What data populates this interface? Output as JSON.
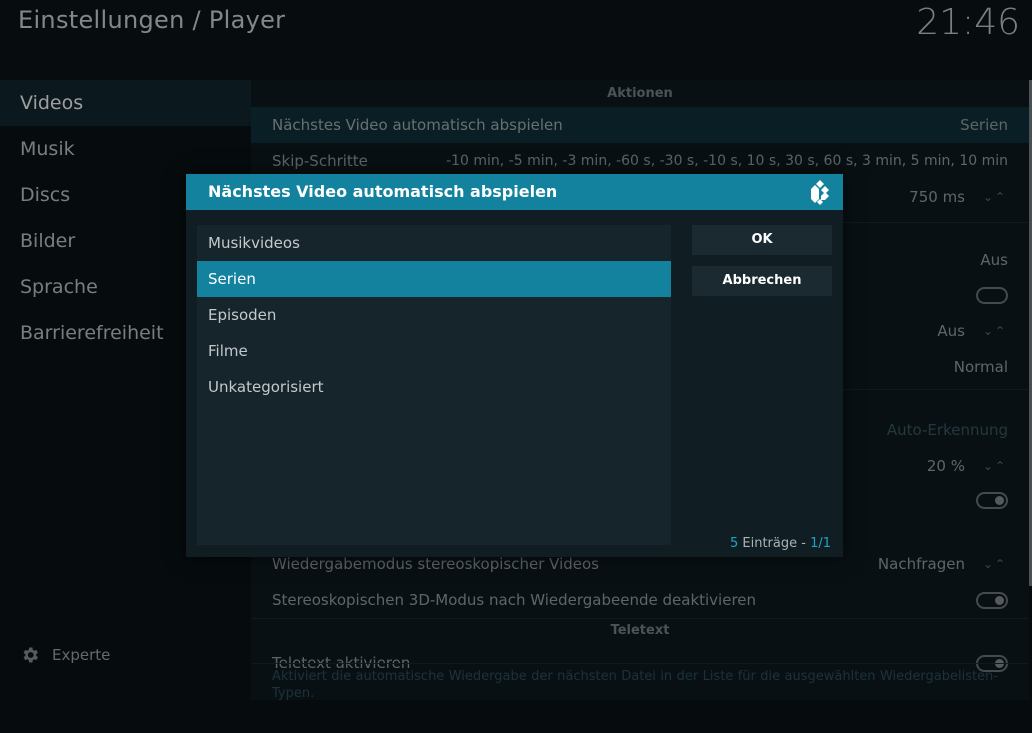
{
  "header": {
    "title": "Einstellungen / Player",
    "clock": "21:46"
  },
  "sidebar": {
    "items": [
      {
        "label": "Videos",
        "active": true
      },
      {
        "label": "Musik"
      },
      {
        "label": "Discs"
      },
      {
        "label": "Bilder"
      },
      {
        "label": "Sprache"
      },
      {
        "label": "Barrierefreiheit"
      }
    ],
    "expert_label": "Experte",
    "expert_icon": "gear-icon"
  },
  "settings": {
    "section_actions": "Aktionen",
    "rows": [
      {
        "label": "Nächstes Video automatisch abspielen",
        "value": "Serien"
      },
      {
        "label": "Skip-Schritte",
        "value": "-10 min, -5 min, -3 min, -60 s, -30 s, -10 s, 10 s, 30 s, 60 s, 3 min, 5 min, 10 min"
      },
      {
        "value": "750 ms"
      },
      {
        "value": "Aus"
      },
      {
        "value": "Aus"
      },
      {
        "value": "Normal"
      },
      {
        "value": "Auto-Erkennung"
      },
      {
        "value": "20 %"
      },
      {
        "label": "Wiedergabemodus stereoskopischer Videos",
        "value": "Nachfragen"
      },
      {
        "label": "Stereoskopischen 3D-Modus nach Wiedergabeende deaktivieren"
      },
      {
        "label": "Teletext aktivieren"
      }
    ],
    "section_teletext": "Teletext",
    "help_text": "Aktiviert die automatische Wiedergabe der nächsten Datei in der Liste für die ausgewählten Wiedergabelisten-Typen."
  },
  "dialog": {
    "title": "Nächstes Video automatisch abspielen",
    "logo_icon": "kodi-logo-icon",
    "options": [
      "Musikvideos",
      "Serien",
      "Episoden",
      "Filme",
      "Unkategorisiert"
    ],
    "selected_index": 1,
    "ok_label": "OK",
    "cancel_label": "Abbrechen",
    "count_num": "5",
    "count_text": " Einträge - ",
    "count_page": "1/1"
  },
  "colors": {
    "accent": "#12829e",
    "background": "#0b1418",
    "panel": "#0f1b20"
  }
}
